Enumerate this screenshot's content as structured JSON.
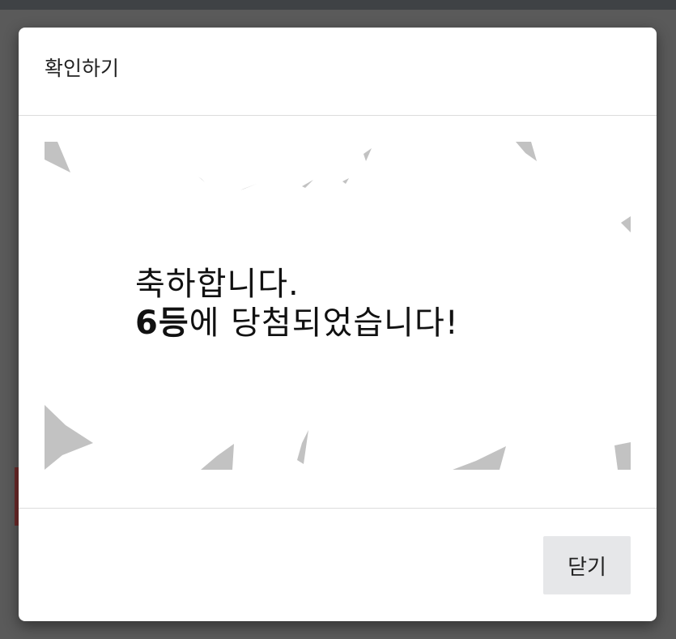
{
  "dialog": {
    "title": "확인하기",
    "message": {
      "line1": "축하합니다.",
      "rank": "6등",
      "line2_rest": "에 당첨되었습니다!"
    },
    "close_label": "닫기"
  }
}
